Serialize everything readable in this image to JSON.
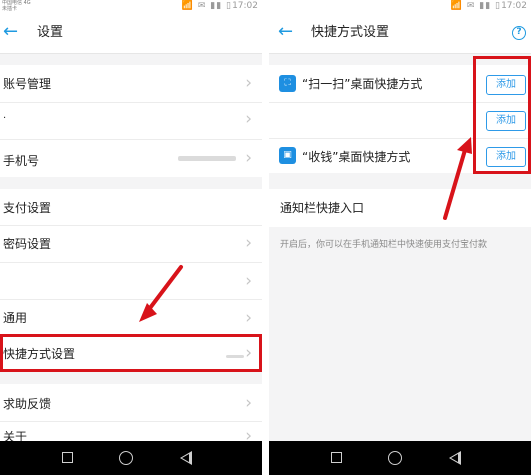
{
  "left": {
    "status": {
      "carrier_line1": "中国电信 4G",
      "carrier_line2": "未插卡",
      "icons": "📶 ✉ ▮▮ ▯",
      "time": "17:02"
    },
    "header": {
      "back_icon": "←",
      "title": "设置"
    },
    "rows": [
      {
        "label": "账号管理"
      },
      {
        "label": ""
      },
      {
        "label": "手机号"
      },
      {
        "label": "支付设置"
      },
      {
        "label": "密码设置"
      },
      {
        "label": ""
      },
      {
        "label": "通用"
      },
      {
        "label": "快捷方式设置"
      },
      {
        "label": "求助反馈"
      },
      {
        "label": "关于"
      }
    ],
    "chevron": "›"
  },
  "right": {
    "status": {
      "icons": "📶 ✉ ▮▮ ▯",
      "time": "17:02"
    },
    "header": {
      "back_icon": "←",
      "title": "快捷方式设置",
      "help_icon": "?"
    },
    "shortcuts": [
      {
        "label": "“扫一扫”桌面快捷方式",
        "icon": "⛶"
      },
      {
        "label": "“收钱”桌面快捷方式",
        "icon": "▣"
      }
    ],
    "add_buttons": [
      "添加",
      "添加",
      "添加"
    ],
    "notification": {
      "title": "通知栏快捷入口",
      "hint": "开启后，你可以在手机通知栏中快速使用支付宝付款"
    }
  },
  "colors": {
    "accent": "#1f9ae0",
    "highlight": "#d8131a",
    "background": "#f4f4f5"
  }
}
